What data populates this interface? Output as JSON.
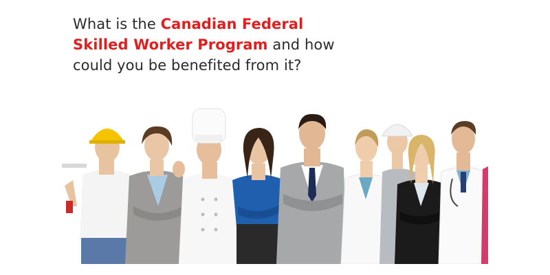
{
  "headline": {
    "prefix": "What is the ",
    "highlight_line1": "Canadian Federal",
    "highlight_line2": "Skilled Worker Program",
    "suffix_line2": " and how",
    "line3": "could you be benefited from it?"
  },
  "colors": {
    "highlight": "#e21f1f",
    "text": "#2b2b2b",
    "background": "#ffffff"
  },
  "photo": {
    "description_icon": "group-of-professionals-image"
  }
}
